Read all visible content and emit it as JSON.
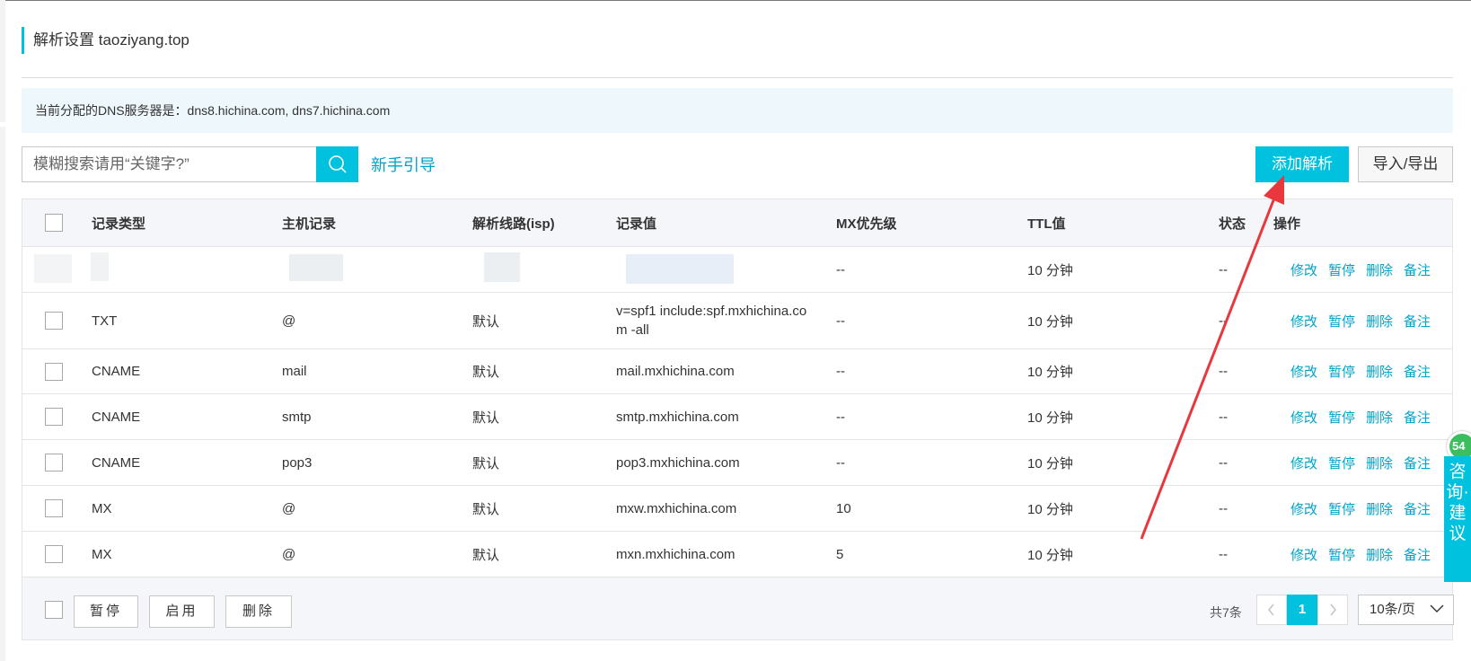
{
  "page": {
    "title": "解析设置 taoziyang.top",
    "dns_notice": "当前分配的DNS服务器是：dns8.hichina.com, dns7.hichina.com"
  },
  "toolbar": {
    "search_placeholder": "模糊搜索请用“关键字?”",
    "guide_link": "新手引导",
    "add_button": "添加解析",
    "import_export_button": "导入/导出"
  },
  "table": {
    "headers": [
      "记录类型",
      "主机记录",
      "解析线路(isp)",
      "记录值",
      "MX优先级",
      "TTL值",
      "状态",
      "操作"
    ],
    "rows": [
      {
        "type": "",
        "host": "",
        "line": "",
        "value": "",
        "mx": "--",
        "ttl": "10 分钟",
        "status": "--",
        "masked": true
      },
      {
        "type": "TXT",
        "host": "@",
        "line": "默认",
        "value": "v=spf1 include:spf.mxhichina.com -all",
        "mx": "--",
        "ttl": "10 分钟",
        "status": "--"
      },
      {
        "type": "CNAME",
        "host": "mail",
        "line": "默认",
        "value": "mail.mxhichina.com",
        "mx": "--",
        "ttl": "10 分钟",
        "status": "--"
      },
      {
        "type": "CNAME",
        "host": "smtp",
        "line": "默认",
        "value": "smtp.mxhichina.com",
        "mx": "--",
        "ttl": "10 分钟",
        "status": "--"
      },
      {
        "type": "CNAME",
        "host": "pop3",
        "line": "默认",
        "value": "pop3.mxhichina.com",
        "mx": "--",
        "ttl": "10 分钟",
        "status": "--"
      },
      {
        "type": "MX",
        "host": "@",
        "line": "默认",
        "value": "mxw.mxhichina.com",
        "mx": "10",
        "ttl": "10 分钟",
        "status": "--"
      },
      {
        "type": "MX",
        "host": "@",
        "line": "默认",
        "value": "mxn.mxhichina.com",
        "mx": "5",
        "ttl": "10 分钟",
        "status": "--"
      }
    ],
    "actions": [
      "修改",
      "暂停",
      "删除",
      "备注"
    ]
  },
  "footer": {
    "pause_button": "暂停",
    "enable_button": "启用",
    "delete_button": "删除",
    "total": "共7条",
    "current_page": "1",
    "page_size": "10条/页"
  },
  "feedback": {
    "badge": "54",
    "label": "咨询·建议"
  },
  "colors": {
    "accent": "#00c1de",
    "link": "#00a2ca",
    "annotation_arrow": "#e8383d"
  }
}
